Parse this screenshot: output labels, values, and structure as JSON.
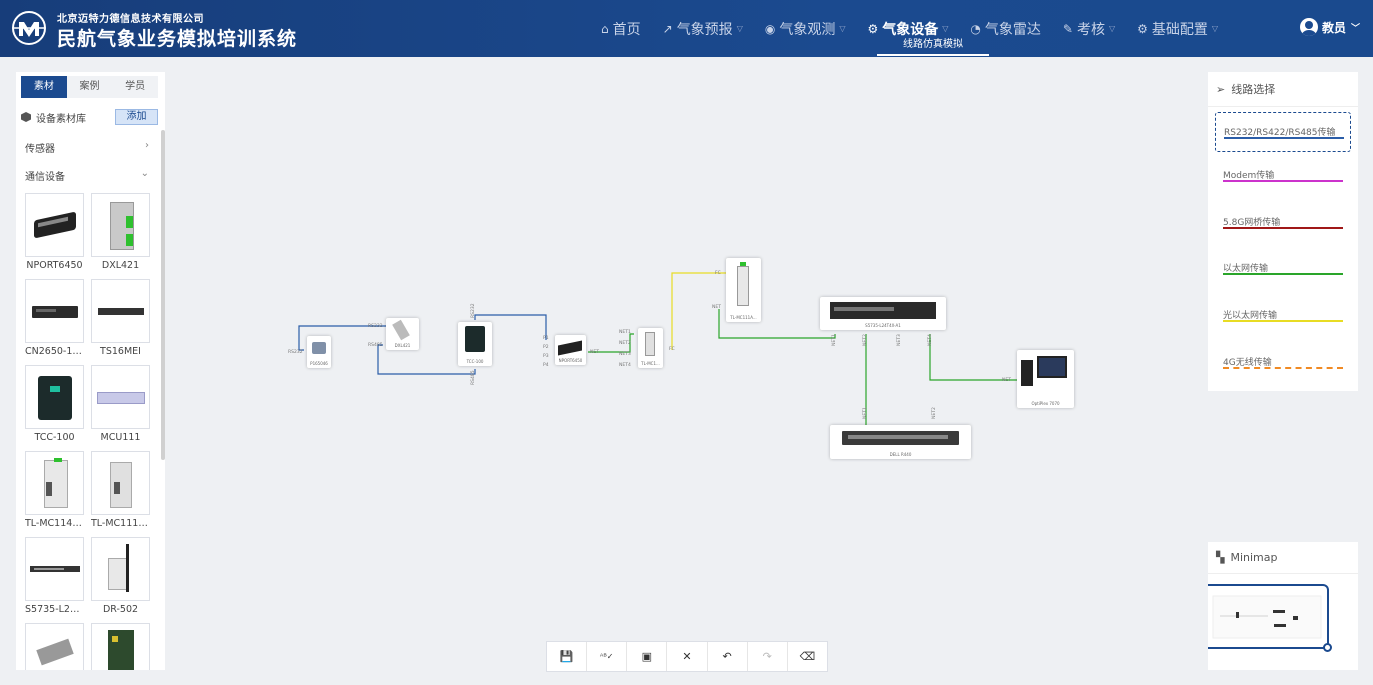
{
  "header": {
    "company": "北京迈特力德信息技术有限公司",
    "title": "民航气象业务模拟培训系统",
    "nav": [
      {
        "label": "首页",
        "icon": "home-icon",
        "glyph": "⌂",
        "dropdown": false
      },
      {
        "label": "气象预报",
        "icon": "chart-icon",
        "glyph": "↗",
        "dropdown": true
      },
      {
        "label": "气象观测",
        "icon": "eye-icon",
        "glyph": "◉",
        "dropdown": true
      },
      {
        "label": "气象设备",
        "icon": "devices-icon",
        "glyph": "⚙",
        "dropdown": true,
        "active": true
      },
      {
        "label": "气象雷达",
        "icon": "radar-icon",
        "glyph": "◔",
        "dropdown": false
      },
      {
        "label": "考核",
        "icon": "pencil-icon",
        "glyph": "✎",
        "dropdown": true
      },
      {
        "label": "基础配置",
        "icon": "gear-icon",
        "glyph": "⚙",
        "dropdown": true
      }
    ],
    "active_sub": "线路仿真模拟",
    "user": "教员"
  },
  "left_panel": {
    "tabs": [
      {
        "label": "素材",
        "active": true
      },
      {
        "label": "案例",
        "active": false
      },
      {
        "label": "学员",
        "active": false
      }
    ],
    "library_label": "设备素材库",
    "add_label": "添加",
    "categories": [
      {
        "label": "传感器",
        "expanded": false
      },
      {
        "label": "通信设备",
        "expanded": true
      }
    ],
    "devices": [
      {
        "label": "NPORT6450"
      },
      {
        "label": "DXL421"
      },
      {
        "label": "CN2650-16-..."
      },
      {
        "label": "TS16MEI"
      },
      {
        "label": "TCC-100"
      },
      {
        "label": "MCU111"
      },
      {
        "label": "TL-MC1148-..."
      },
      {
        "label": "TL-MC111A..."
      },
      {
        "label": "S5735-L24T..."
      },
      {
        "label": "DR-502"
      },
      {
        "label": ""
      },
      {
        "label": ""
      }
    ]
  },
  "route_panel": {
    "title": "线路选择",
    "routes": [
      {
        "label": "RS232/RS422/RS485传输",
        "color": "#2b5da8",
        "style": "solid",
        "selected": true
      },
      {
        "label": "Modem传输",
        "color": "#cc33cc",
        "style": "solid"
      },
      {
        "label": "5.8G网桥传输",
        "color": "#a01818",
        "style": "solid"
      },
      {
        "label": "以太网传输",
        "color": "#2aa52a",
        "style": "solid"
      },
      {
        "label": "光以太网传输",
        "color": "#e8dc24",
        "style": "solid"
      },
      {
        "label": "4G无线传输",
        "color": "#f08a24",
        "style": "dashed"
      }
    ]
  },
  "minimap": {
    "title": "Minimap"
  },
  "canvas": {
    "nodes": {
      "n1": "P165046",
      "n2": "DXL421",
      "n3": "TCC-100",
      "n4": "NPORT6450",
      "n5": "TL-MC1...",
      "n6": "TL-MC111A...",
      "n7": "S5735-L24T4X-A1",
      "n8": "OptiPlex 7070",
      "n9": "DELL R440"
    },
    "ports": {
      "p1": "RS232",
      "p2": "RS485",
      "p3": "RS232",
      "p4": "RS232",
      "p5": "RS485",
      "p6": "P1",
      "p7": "P2",
      "p8": "P3",
      "p9": "P4",
      "p10": "NET",
      "p11": "NET1",
      "p12": "NET2",
      "p13": "NET3",
      "p14": "NET4",
      "p15": "FC",
      "p16": "FC",
      "p17": "NET",
      "p18": "NET1",
      "p19": "NET2",
      "p20": "NET3",
      "p21": "NET4",
      "p22": "NET",
      "p23": "NET1",
      "p24": "NET2"
    }
  },
  "toolbar": [
    {
      "name": "save-button",
      "icon": "save-icon",
      "glyph": "💾",
      "enabled": true
    },
    {
      "name": "spellcheck-button",
      "icon": "spellcheck-icon",
      "glyph": "ᴬᴮ✓",
      "enabled": true
    },
    {
      "name": "image-button",
      "icon": "image-icon",
      "glyph": "▣",
      "enabled": true
    },
    {
      "name": "fit-button",
      "icon": "fit-icon",
      "glyph": "✕",
      "enabled": true
    },
    {
      "name": "undo-button",
      "icon": "undo-icon",
      "glyph": "↶",
      "enabled": true
    },
    {
      "name": "redo-button",
      "icon": "redo-icon",
      "glyph": "↷",
      "enabled": false
    },
    {
      "name": "eraser-button",
      "icon": "eraser-icon",
      "glyph": "⌫",
      "enabled": true
    }
  ]
}
